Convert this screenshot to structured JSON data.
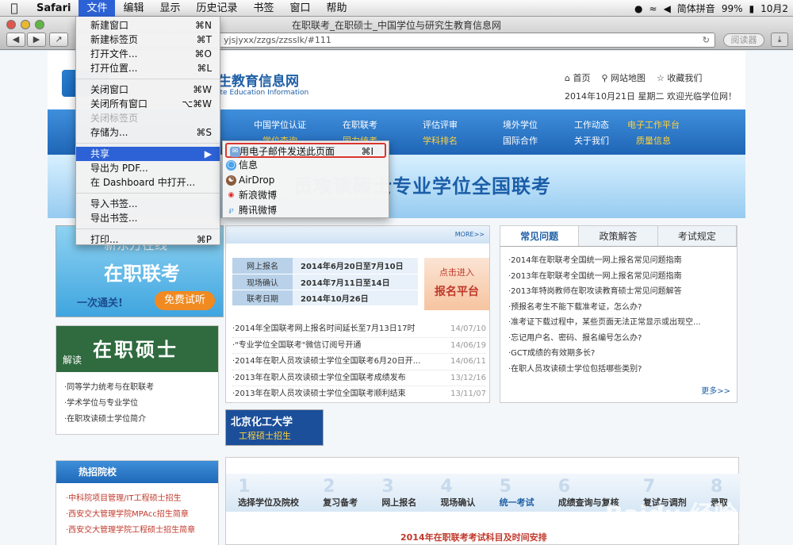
{
  "menubar": {
    "apple": "",
    "app": "Safari",
    "items": [
      "文件",
      "编辑",
      "显示",
      "历史记录",
      "书签",
      "窗口",
      "帮助"
    ],
    "status": {
      "input": "简体拼音",
      "battery": "99%",
      "clock": "10月2"
    }
  },
  "window": {
    "title": "在职联考_在职硕士_中国学位与研究生教育信息网",
    "url": "yjsjyxx/zzgs/zzsslk/#111",
    "reader": "阅读器"
  },
  "file_menu": {
    "items": [
      {
        "label": "新建窗口",
        "shortcut": "⌘N"
      },
      {
        "label": "新建标签页",
        "shortcut": "⌘T"
      },
      {
        "label": "打开文件...",
        "shortcut": "⌘O"
      },
      {
        "label": "打开位置...",
        "shortcut": "⌘L"
      },
      {
        "label": "关闭窗口",
        "shortcut": "⌘W"
      },
      {
        "label": "关闭所有窗口",
        "shortcut": "⌥⌘W"
      },
      {
        "label": "关闭标签页",
        "shortcut": ""
      },
      {
        "label": "存储为...",
        "shortcut": "⌘S"
      },
      {
        "label": "共享",
        "shortcut": "▶"
      },
      {
        "label": "导出为 PDF...",
        "shortcut": ""
      },
      {
        "label": "在 Dashboard 中打开...",
        "shortcut": ""
      },
      {
        "label": "导入书签...",
        "shortcut": ""
      },
      {
        "label": "导出书签...",
        "shortcut": ""
      },
      {
        "label": "打印...",
        "shortcut": "⌘P"
      }
    ]
  },
  "share_menu": {
    "items": [
      {
        "label": "用电子邮件发送此页面",
        "shortcut": "⌘I"
      },
      {
        "label": "信息",
        "shortcut": ""
      },
      {
        "label": "AirDrop",
        "shortcut": ""
      },
      {
        "label": "新浪微博",
        "shortcut": ""
      },
      {
        "label": "腾讯微博",
        "shortcut": ""
      }
    ]
  },
  "site": {
    "logo_title": "生教育信息网",
    "logo_sub": "ate Education Information",
    "links": [
      "首页",
      "网站地图",
      "收藏我们"
    ],
    "date": "2014年10月21日 星期二  欢迎光临学位网！",
    "nav": [
      {
        "top": "中国学位认证",
        "bottom": "学位查询"
      },
      {
        "top": "在职联考",
        "bottom": "同力统考"
      },
      {
        "top": "评估评审",
        "bottom": "学科排名"
      },
      {
        "top": "境外学位",
        "bottom": "国际合作"
      },
      {
        "top": "工作动态",
        "bottom": "关于我们"
      },
      {
        "top": "电子工作平台",
        "bottom": "质量信息"
      }
    ],
    "banner": "员攻读硕士专业学位全国联考",
    "ad1": {
      "a": "新东方在线",
      "b": "在职联考",
      "c": "一次通关!",
      "d": "免费试听"
    },
    "ad2": {
      "k": "解读",
      "t": "在职硕士",
      "items": [
        "·同等学力统考与在职联考",
        "·学术学位与专业学位",
        "·在职攻读硕士学位简介"
      ]
    },
    "hot": {
      "title": "热招院校",
      "items": [
        "·中科院项目管理/IT工程硕士招生",
        "·西安交大管理学院MPAcc招生简章",
        "·西安交大管理学院工程硕士招生简章"
      ]
    },
    "more_tag": "MORE>>",
    "reg": {
      "rows": [
        {
          "k": "网上报名",
          "v": "2014年6月20日至7月10日"
        },
        {
          "k": "现场确认",
          "v": "2014年7月11日至14日"
        },
        {
          "k": "联考日期",
          "v": "2014年10月26日"
        }
      ],
      "btn_small": "点击进入",
      "btn_large": "报名平台"
    },
    "news": [
      {
        "t": "·2014年全国联考网上报名时间延长至7月13日17时",
        "d": "14/07/10"
      },
      {
        "t": "·\"专业学位全国联考\"微信订阅号开通",
        "d": "14/06/19"
      },
      {
        "t": "·2014年在职人员攻读硕士学位全国联考6月20日开...",
        "d": "14/06/11"
      },
      {
        "t": "·2013年在职人员攻读硕士学位全国联考成绩发布",
        "d": "13/12/16"
      },
      {
        "t": "·2013年在职人员攻读硕士学位全国联考顺利结束",
        "d": "13/11/07"
      }
    ],
    "faq": {
      "tabs": [
        "常见问题",
        "政策解答",
        "考试规定"
      ],
      "items": [
        "·2014年在职联考全国统一网上报名常见问题指南",
        "·2013年在职联考全国统一网上报名常见问题指南",
        "·2013年特岗教师在职攻读教育硕士常见问题解答",
        "·预报名考生不能下载准考证，怎么办?",
        "·准考证下载过程中，某些页面无法正常显示或出现空...",
        "·忘记用户名、密码、报名编号怎么办?",
        "·GCT成绩的有效期多长?",
        "·在职人员攻读硕士学位包括哪些类别?"
      ],
      "more": "更多>>"
    },
    "bhu": {
      "n": "北京化工大学",
      "e": "工程硕士招生"
    },
    "steps": [
      {
        "n": "1",
        "t": "选择学位及院校"
      },
      {
        "n": "2",
        "t": "复习备考"
      },
      {
        "n": "3",
        "t": "网上报名"
      },
      {
        "n": "4",
        "t": "现场确认"
      },
      {
        "n": "5",
        "t": "统一考试"
      },
      {
        "n": "6",
        "t": "成绩查询与复核"
      },
      {
        "n": "7",
        "t": "复试与调剂"
      },
      {
        "n": "8",
        "t": "录取"
      }
    ],
    "flow_foot": "2014年在职联考考试科目及时间安排"
  },
  "watermark": {
    "main": "Baidu 经验",
    "sub": "jingyan.baidu.com"
  }
}
